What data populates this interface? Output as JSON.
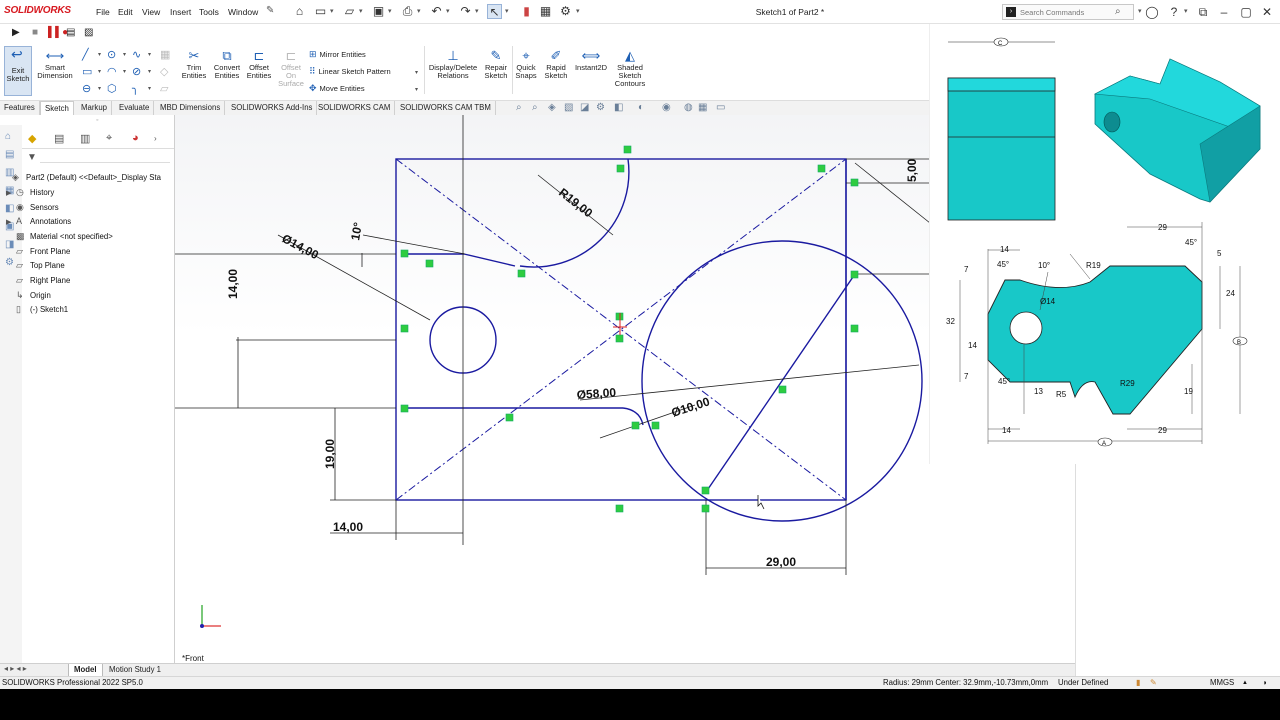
{
  "app": {
    "logo": "SOLIDWORKS",
    "document_title": "Sketch1 of Part2 *"
  },
  "menu": [
    "File",
    "Edit",
    "View",
    "Insert",
    "Tools",
    "Window"
  ],
  "search": {
    "placeholder": "Search Commands"
  },
  "commands": {
    "exit_sketch": "Exit Sketch",
    "smart_dimension": "Smart Dimension",
    "trim": "Trim Entities",
    "convert": "Convert Entities",
    "offset": "Offset Entities",
    "offset_surface": "Offset On Surface",
    "mirror": "Mirror Entities",
    "linear_pattern": "Linear Sketch Pattern",
    "move": "Move Entities",
    "display_delete": "Display/Delete Relations",
    "repair": "Repair Sketch",
    "quick_snaps": "Quick Snaps",
    "rapid_sketch": "Rapid Sketch",
    "instant2d": "Instant2D",
    "shaded_contours": "Shaded Sketch Contours"
  },
  "tabs": [
    "Features",
    "Sketch",
    "Markup",
    "Evaluate",
    "MBD Dimensions",
    "SOLIDWORKS Add-Ins",
    "SOLIDWORKS CAM",
    "SOLIDWORKS CAM TBM"
  ],
  "active_tab": "Sketch",
  "feature_tree": [
    {
      "label": "Part2 (Default) <<Default>_Display Sta",
      "icon": "part-icon",
      "expand": ""
    },
    {
      "label": "History",
      "icon": "history-icon",
      "expand": "▶"
    },
    {
      "label": "Sensors",
      "icon": "sensor-icon",
      "expand": ""
    },
    {
      "label": "Annotations",
      "icon": "annotation-icon",
      "expand": "▶"
    },
    {
      "label": "Material <not specified>",
      "icon": "material-icon",
      "expand": ""
    },
    {
      "label": "Front Plane",
      "icon": "plane-icon",
      "expand": ""
    },
    {
      "label": "Top Plane",
      "icon": "plane-icon",
      "expand": ""
    },
    {
      "label": "Right Plane",
      "icon": "plane-icon",
      "expand": ""
    },
    {
      "label": "Origin",
      "icon": "origin-icon",
      "expand": ""
    },
    {
      "label": "(-) Sketch1",
      "icon": "sketch-icon",
      "expand": ""
    }
  ],
  "sketch": {
    "view_label": "*Front",
    "dimensions": {
      "r19": "R19,00",
      "d14": "Ø14,00",
      "ang10": "10°",
      "v14": "14,00",
      "v19": "19,00",
      "h14": "14,00",
      "d58": "Ø58,00",
      "d10": "Ø10,00",
      "h29": "29,00",
      "v5": "5,00"
    }
  },
  "reference_drawing": {
    "labels": {
      "c": "C",
      "a": "A",
      "b": "B",
      "d14": "Ø14",
      "r19": "R19",
      "r29": "R29",
      "r5": "R5",
      "n14a": "14",
      "n14b": "14",
      "n14c": "14",
      "n29a": "29",
      "n29b": "29",
      "n32": "32",
      "n24": "24",
      "n19": "19",
      "n13": "13",
      "n7a": "7",
      "n7b": "7",
      "n5": "5",
      "a45a": "45°",
      "a45b": "45°",
      "a45c": "45°",
      "a10": "10°"
    },
    "colors": {
      "fill": "#18c8c8",
      "top": "#22d8dc",
      "dark": "#119fa4"
    }
  },
  "bottom_tabs": [
    "Model",
    "Motion Study 1"
  ],
  "status": {
    "product": "SOLIDWORKS Professional 2022 SP5.0",
    "measure": "Radius: 29mm  Center: 32.9mm,-10.73mm,0mm",
    "state": "Under Defined",
    "units": "MMGS"
  },
  "colors": {
    "sketch_line": "#1a1aa0",
    "relation": "#2ecc40",
    "brand": "#d71920"
  }
}
